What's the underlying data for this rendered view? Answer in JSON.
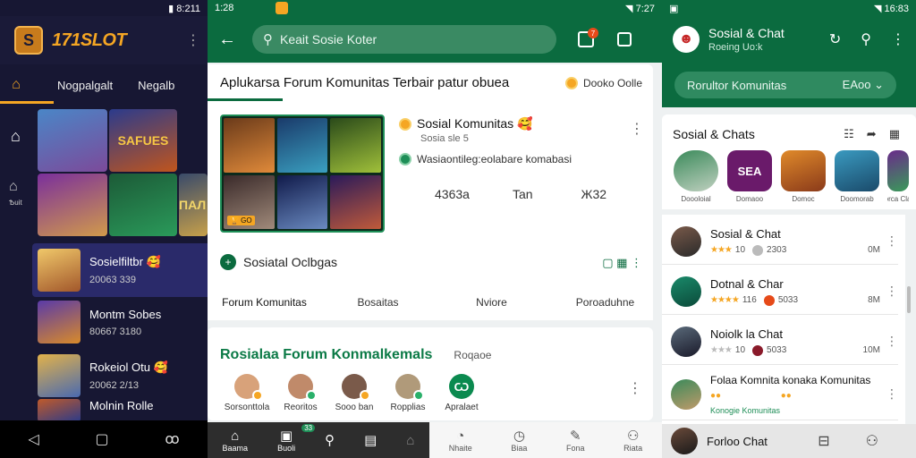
{
  "left": {
    "status_time": "8:211",
    "logo_text": "171SLOT",
    "tabs": [
      "Nogpalgalt",
      "Negalb"
    ],
    "side_label": "Ѣuit",
    "tile_text_1": "SAFUES",
    "tile_text_2": "ПАЛ",
    "featured": [
      {
        "name": "Sosielfiltbr 🥰",
        "sub": "20063 339"
      },
      {
        "name": "Montm Sobes",
        "sub": "80667 3180"
      },
      {
        "name": "Rokeiol Otu 🥰",
        "sub": "20062 2/13"
      },
      {
        "name": "Molnin Rolle",
        "sub": ""
      }
    ],
    "colors": {
      "accent": "#f5a623",
      "bg": "#171733"
    }
  },
  "middle": {
    "status_time": "1:28",
    "status_time_right": "7:27",
    "search_placeholder": "Keait Sosie Koter",
    "header_title": "Aplukarsa Forum Komunitas Terbair patur obuea",
    "header_chip": "Dooko Oolle",
    "app": {
      "name": "Sosial Komunitas 🥰",
      "sub1": "Sosia sle 5",
      "desc": "Wasiaontileg:eolabare komabasi",
      "stats": [
        "4363a",
        "Tan",
        "Ж32"
      ],
      "thumb_label": "🏆 GO"
    },
    "sub_title": "Sosiatal Oclbgas",
    "segments": [
      "Forum Komunitas",
      "Bosaitas",
      "Nviore",
      "Poroaduhne"
    ],
    "section_title": "Rosialaa Forum Konmalkemals",
    "section_chip": "Roqaoe",
    "avatars": [
      "Sorsonttola",
      "Reoritos",
      "Sooo ban",
      "Ropplias",
      "Apralaet"
    ],
    "nav": [
      {
        "label": "Baama",
        "icon": "⌂"
      },
      {
        "label": "Buoli",
        "icon": "▣",
        "badge": "1"
      },
      {
        "label": "",
        "icon": "⚲"
      },
      {
        "label": "",
        "icon": "▤"
      },
      {
        "label": "",
        "icon": "⌂"
      },
      {
        "label": "Nhaite",
        "icon": "◔"
      },
      {
        "label": "Biaa",
        "icon": "◷"
      },
      {
        "label": "Fona",
        "icon": "✎"
      },
      {
        "label": "Riata",
        "icon": "⚇"
      }
    ],
    "badge_count": "7",
    "nav_badge_2": "33",
    "colors": {
      "primary": "#0b6b3f"
    }
  },
  "right": {
    "status_time": "16:83",
    "title": "Sosial & Chat",
    "subtitle": "Roeing Uo:k",
    "pill_left": "Rorultor Komunitas",
    "pill_right": "EAoo",
    "section_title": "Sosial & Chats",
    "apps": [
      {
        "label": "Doooloial",
        "text": ""
      },
      {
        "label": "Domaoo",
        "text": "SEA"
      },
      {
        "label": "Domoc",
        "text": ""
      },
      {
        "label": "Doomorab",
        "text": ""
      },
      {
        "label": "Sorca Claln",
        "text": ""
      }
    ],
    "list": [
      {
        "name": "Sosial & Chat",
        "rating": "10",
        "count": "2303",
        "size": "0M"
      },
      {
        "name": "Dotnal & Char",
        "rating": "116",
        "count": "5033",
        "size": "8M"
      },
      {
        "name": "Noiolk la Chat",
        "rating": "10",
        "count": "5033",
        "size": "10M"
      },
      {
        "name": "Folaa Komnita konaka Komunitas",
        "rating": "",
        "count": "",
        "size": "",
        "sub2": "Konogie Komunitas"
      },
      {
        "name": "Forloo Chat",
        "rating": "",
        "count": "",
        "size": ""
      }
    ],
    "nav_icons": [
      "⊟",
      "⚇"
    ]
  }
}
